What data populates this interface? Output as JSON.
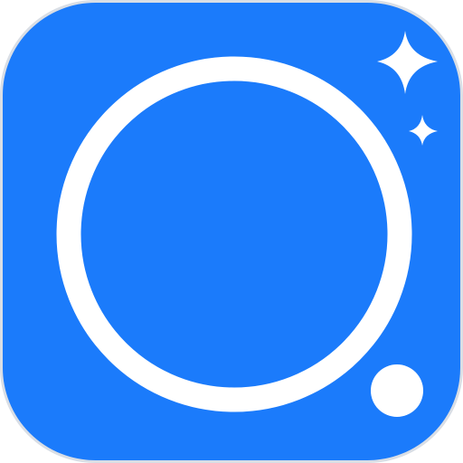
{
  "icon": {
    "name": "camera-app-icon",
    "shape": "rounded-square",
    "colors": {
      "background": "#1B7BFB",
      "border": "#D9DEE5",
      "foreground": "#FFFFFF"
    },
    "glyphs": [
      "lens-ring-icon",
      "sparkle-large-icon",
      "sparkle-small-icon",
      "dot-icon"
    ]
  }
}
